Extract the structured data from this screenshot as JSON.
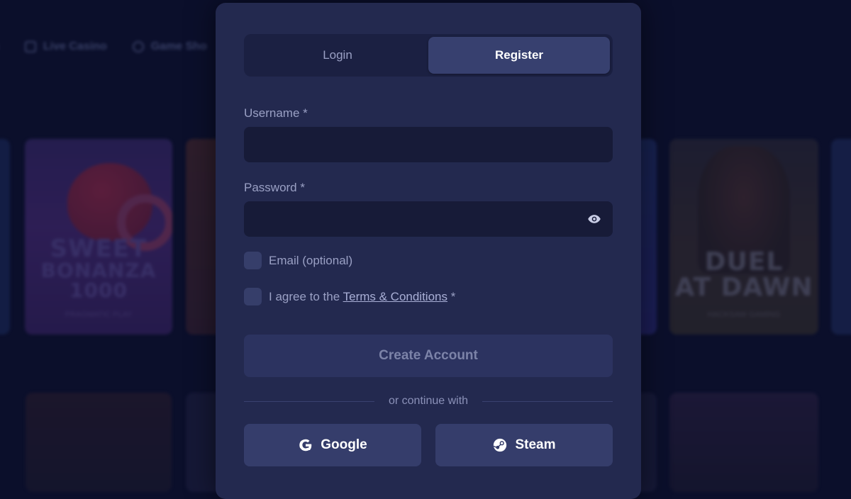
{
  "background": {
    "nav": [
      {
        "label": "Live Casino",
        "icon": "live-casino-icon"
      },
      {
        "label": "Game Sho",
        "icon": "game-show-icon"
      }
    ],
    "cards": [
      {
        "title_line1": "SWEET",
        "title_line2": "BONANZA",
        "title_line3": "1000",
        "provider": "PRAGMATIC PLAY"
      },
      {
        "title_line1": "DUEL",
        "title_line2": "AT DAWN",
        "provider": "HACKSAW GAMING"
      }
    ]
  },
  "auth": {
    "tabs": {
      "login": "Login",
      "register": "Register"
    },
    "active_tab": "Register",
    "username": {
      "label": "Username *",
      "value": ""
    },
    "password": {
      "label": "Password *",
      "value": ""
    },
    "email_optional": {
      "label": "Email (optional)",
      "checked": false
    },
    "terms": {
      "prefix": "I agree to the ",
      "link": "Terms & Conditions",
      "suffix": " *",
      "checked": false
    },
    "create_button": "Create Account",
    "divider_text": "or continue with",
    "google_button": "Google",
    "steam_button": "Steam"
  },
  "colors": {
    "page_bg": "#0b0f2b",
    "modal_bg": "#23294f",
    "active_tab": "#37406f",
    "input_bg": "#171b38"
  }
}
